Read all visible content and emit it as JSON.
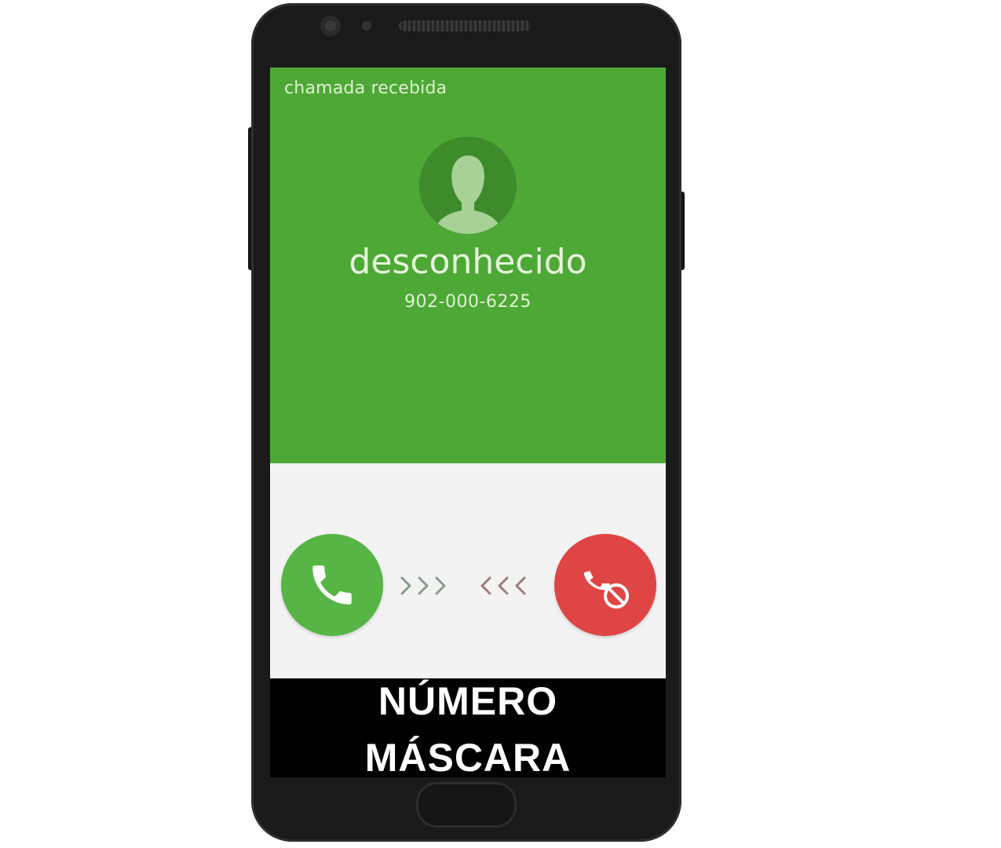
{
  "call_screen": {
    "status_label": "chamada recebida",
    "caller_name": "desconhecido",
    "caller_number": "902-000-6225"
  },
  "actions": {
    "accept_icon": "phone-icon",
    "reject_icon": "phone-hangup-block-icon"
  },
  "caption": {
    "line1": "NÚMERO",
    "line2": "MÁSCARA"
  },
  "colors": {
    "header_green": "#4ea836",
    "accept_green": "#56b544",
    "reject_red": "#e04545",
    "caption_bg": "#000000"
  }
}
